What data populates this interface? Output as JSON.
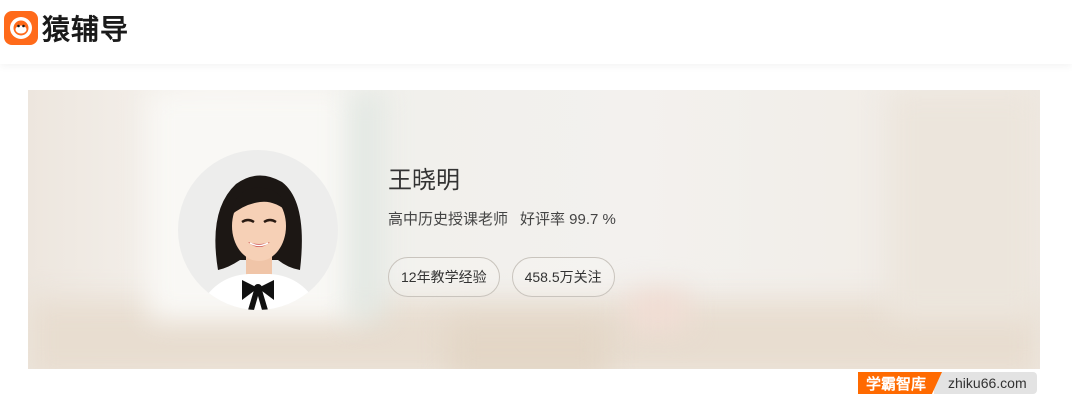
{
  "header": {
    "logo_text": "猿辅导",
    "logo_icon": "monkey-face-icon",
    "brand_color": "#ff6a1a"
  },
  "teacher": {
    "name": "王晓明",
    "role": "高中历史授课老师",
    "rating": "好评率 99.7 %",
    "tags": [
      "12年教学经验",
      "458.5万关注"
    ]
  },
  "watermark": {
    "left_text": "学霸智库",
    "right_text": "zhiku66.com",
    "accent": "#ff6a00"
  }
}
